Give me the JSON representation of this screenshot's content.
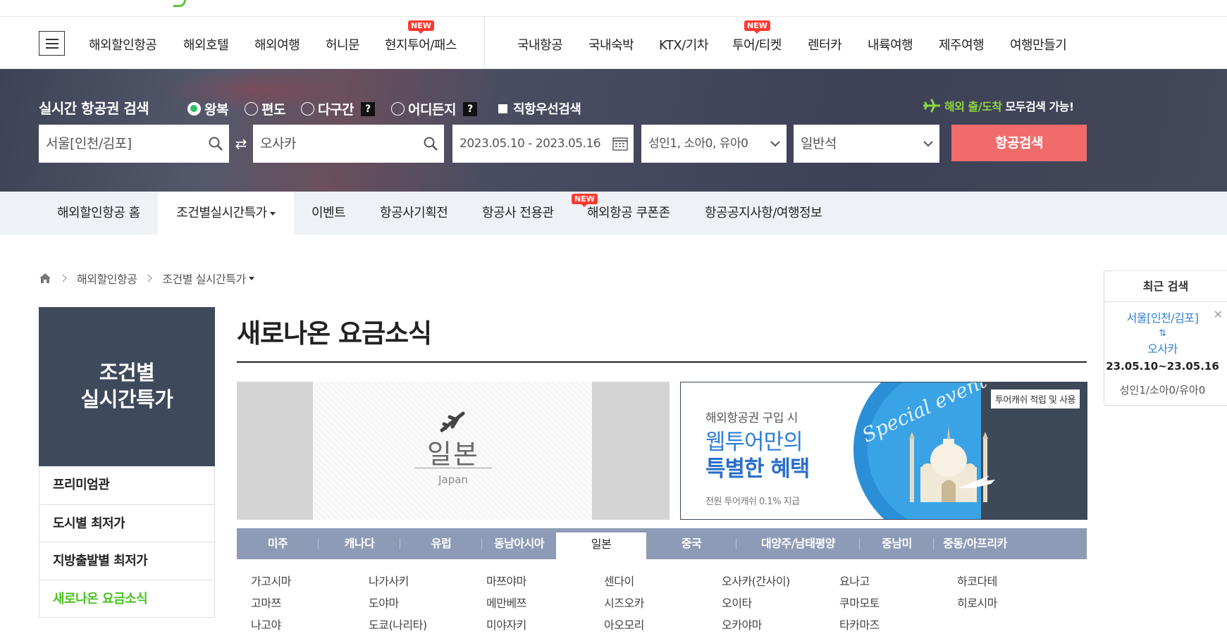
{
  "gnb": {
    "left_items": [
      "해외할인항공",
      "해외호텔",
      "해외여행",
      "허니문",
      "현지투어/패스"
    ],
    "right_items": [
      "국내항공",
      "국내숙박",
      "KTX/기차",
      "투어/티켓",
      "렌터카",
      "내륙여행",
      "제주여행",
      "여행만들기"
    ],
    "new_badge": "NEW"
  },
  "search": {
    "title": "실시간 항공권 검색",
    "trip_types": [
      "왕복",
      "편도",
      "다구간",
      "어디든지"
    ],
    "help": "?",
    "direct_first": "직항우선검색",
    "promo_green": "해외 출/도착",
    "promo_white": "모두검색 가능!",
    "origin": "서울[인천/김포]",
    "destination": "오사카",
    "dates": "2023.05.10 - 2023.05.16",
    "passengers": "성인1, 소아0, 유아0",
    "cabin": "일반석",
    "button": "항공검색"
  },
  "lnb": {
    "items": [
      "해외할인항공 홈",
      "조건별실시간특가",
      "이벤트",
      "항공사기획전",
      "항공사 전용관",
      "해외항공 쿠폰존",
      "항공공지사항/여행정보"
    ],
    "new_badge": "NEW"
  },
  "breadcrumb": [
    "해외할인항공",
    "조건별 실시간특가"
  ],
  "side": {
    "title_line1": "조건별",
    "title_line2": "실시간특가",
    "items": [
      "프리미엄관",
      "도시별 최저가",
      "지방출발별 최저가",
      "새로나온 요금소식"
    ]
  },
  "main": {
    "title": "새로나온 요금소식",
    "japan_ko": "일본",
    "japan_en": "Japan"
  },
  "banner": {
    "pill": "투어캐쉬 적립 및 사용",
    "line1": "해외항공권 구입 시",
    "line2": "웹투어만의",
    "line3": "특별한 혜택",
    "line4": "전원 투어캐쉬 0.1% 지급",
    "script": "Special event"
  },
  "regions": [
    "미주",
    "캐나다",
    "유럽",
    "동남아시아",
    "일본",
    "중국",
    "대양주/남태평양",
    "중남미",
    "중동/아프리카"
  ],
  "cities": [
    [
      "가고시마",
      "고마쯔",
      "나고야"
    ],
    [
      "나가사키",
      "도야마",
      "도쿄(나리타)"
    ],
    [
      "마쯔야마",
      "메만베쯔",
      "미야자키"
    ],
    [
      "센다이",
      "시즈오카",
      "아오모리"
    ],
    [
      "오사카(간사이)",
      "오이타",
      "오카야마"
    ],
    [
      "요나고",
      "쿠마모토",
      "타카마즈"
    ],
    [
      "하코다테",
      "히로시마"
    ]
  ],
  "recent": {
    "title": "최근 검색",
    "from": "서울[인천/김포]",
    "arrow": "⇅",
    "to": "오사카",
    "dates": "23.05.10~23.05.16",
    "pax": "성인1/소아0/유아0",
    "close": "✕"
  }
}
